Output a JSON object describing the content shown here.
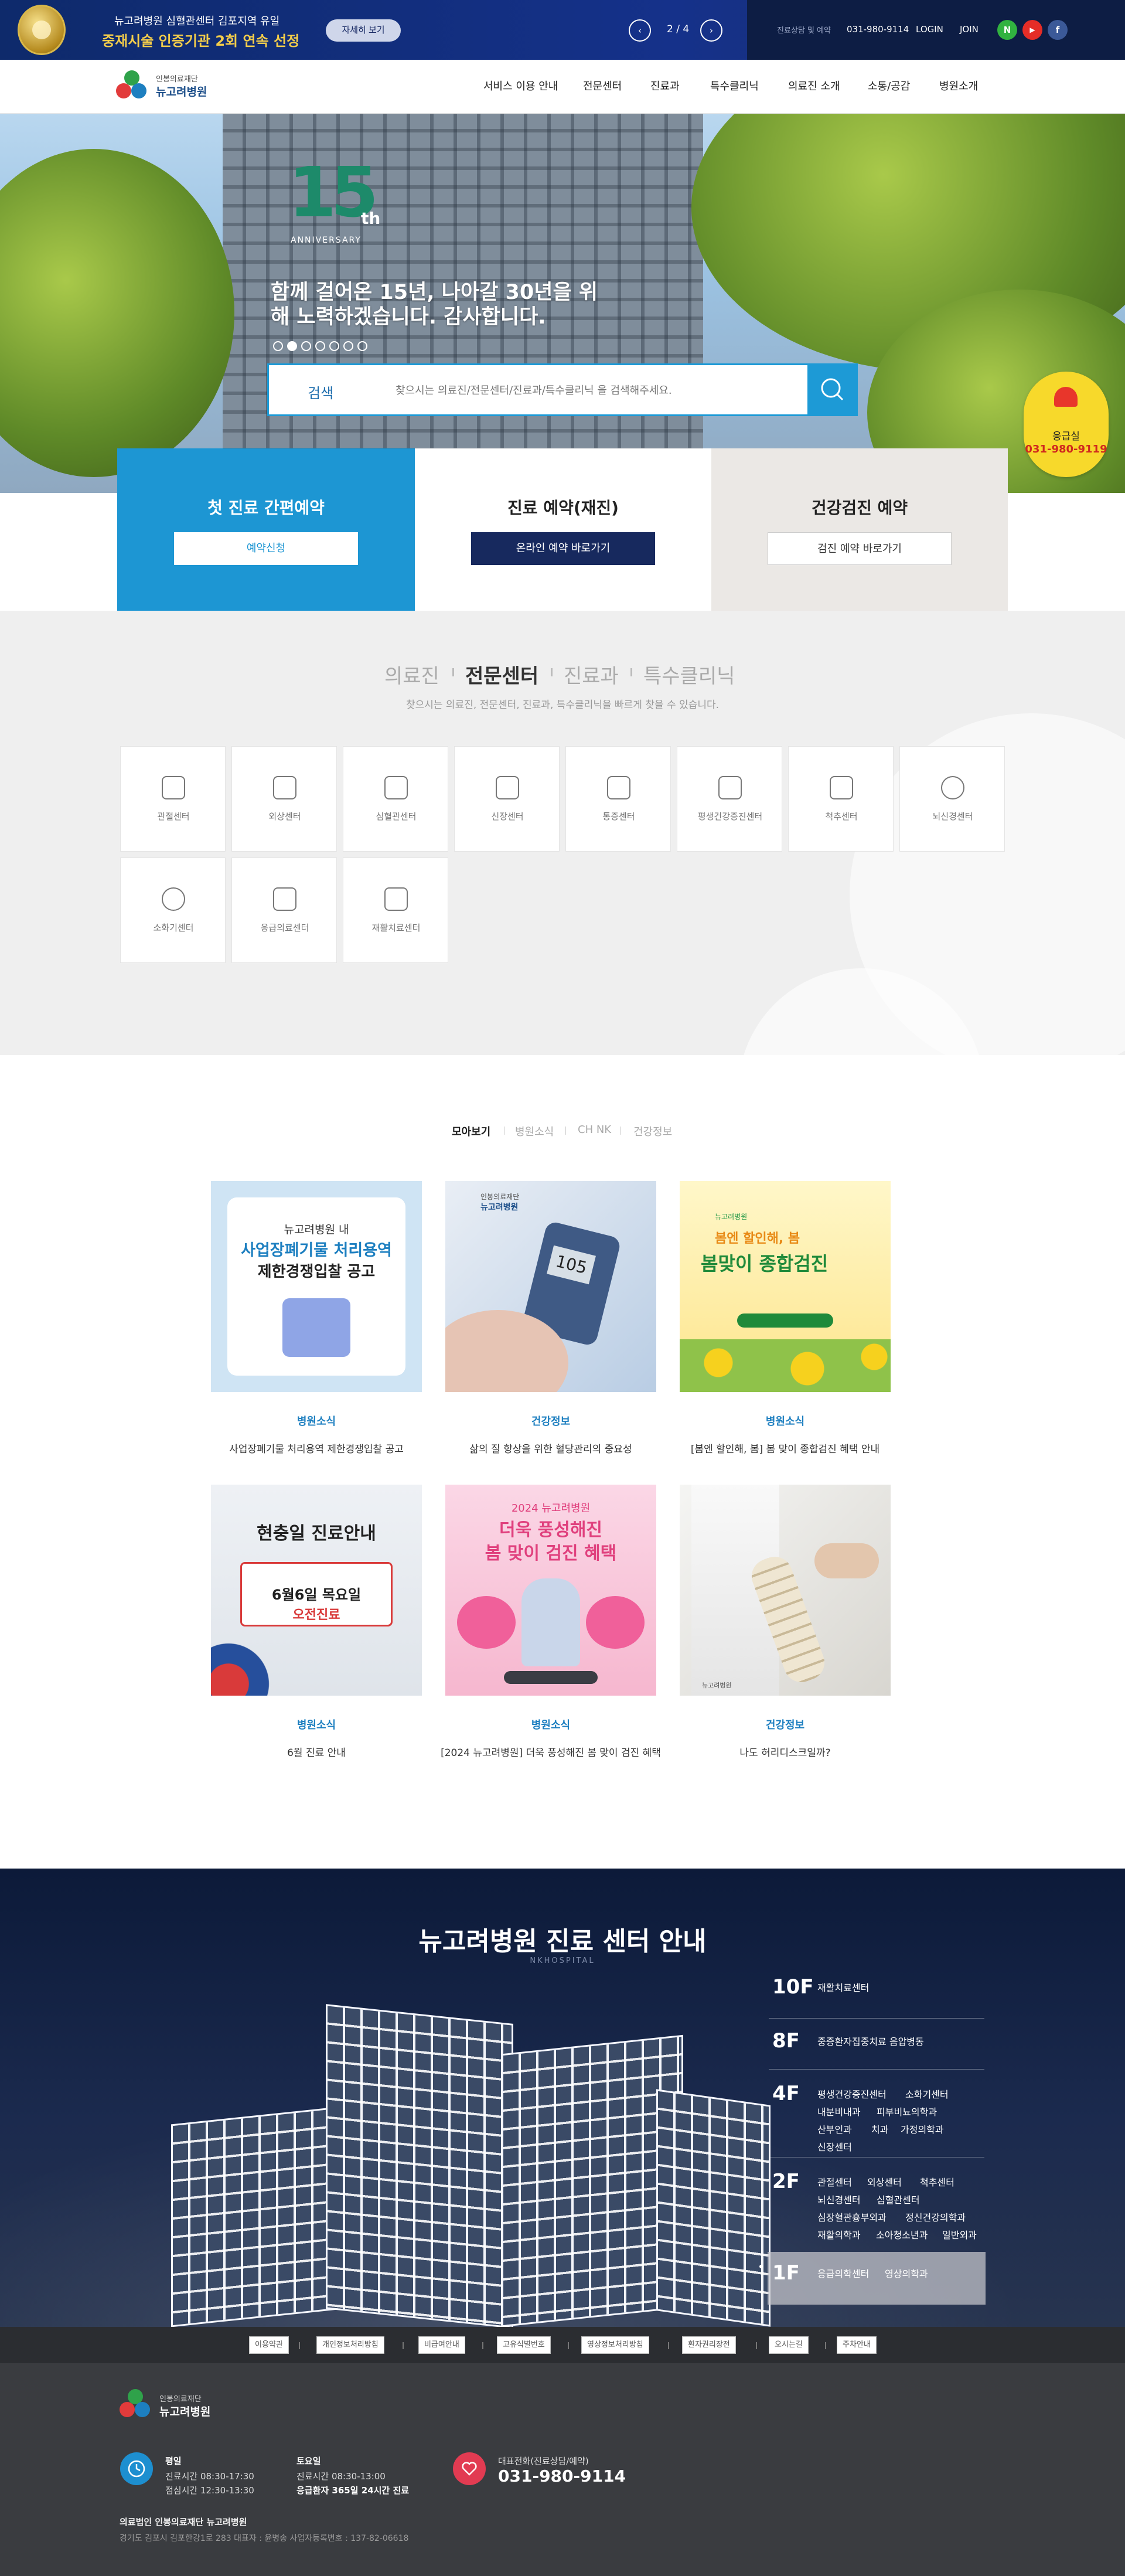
{
  "topbar": {
    "line1": "뉴고려병원 심혈관센터 김포지역 유일",
    "line2": "중재시술 인증기관 2회 연속 선정",
    "detail_btn": "자세히 보기",
    "pager": "2 / 4",
    "prev_icon": "‹",
    "next_icon": "›",
    "phone_label": "진료상담 및 예약",
    "phone": "031-980-9114",
    "login": "LOGIN",
    "join": "JOIN",
    "social": [
      "N",
      "▶",
      "f"
    ]
  },
  "header": {
    "logo_top": "인봉의료재단",
    "logo_main": "뉴고려병원",
    "nav": [
      "서비스 이용 안내",
      "전문센터",
      "진료과",
      "특수클리닉",
      "의료진 소개",
      "소통/공감",
      "병원소개"
    ]
  },
  "hero": {
    "anniv_num": "15",
    "anniv_th": "th",
    "anniv_sub": "ANNIVERSARY",
    "message": "함께 걸어온 15년, 나아갈 30년을 위해 노력하겠습니다. 감사합니다.",
    "dot_count": 7,
    "active_dot": 1,
    "search_label": "검색",
    "search_placeholder": "찾으시는 의료진/전문센터/진료과/특수클리닉 을 검색해주세요."
  },
  "emergency": {
    "label": "응급실",
    "phone": "031-980-9119"
  },
  "quick_cards": [
    {
      "title": "첫 진료 간편예약",
      "button": "예약신청"
    },
    {
      "title": "진료 예약(재진)",
      "button": "온라인 예약 바로가기"
    },
    {
      "title": "건강검진 예약",
      "button": "검진 예약 바로가기"
    }
  ],
  "category": {
    "tabs": [
      "의료진",
      "전문센터",
      "진료과",
      "특수클리닉"
    ],
    "active_tab": 1,
    "description": "찾으시는 의료진, 전문센터, 진료과, 특수클리닉을 빠르게 찾을 수 있습니다.",
    "centers": [
      "관절센터",
      "외상센터",
      "심혈관센터",
      "신장센터",
      "통증센터",
      "평생건강증진센터",
      "척추센터",
      "뇌신경센터",
      "소화기센터",
      "응급의료센터",
      "재활치료센터"
    ]
  },
  "news": {
    "tabs": [
      "모아보기",
      "병원소식",
      "CH NK",
      "건강정보"
    ],
    "active_tab": 0,
    "items": [
      {
        "category": "병원소식",
        "title": "사업장폐기물 처리용역 제한경쟁입찰 공고",
        "img_line1": "뉴고려병원 내",
        "img_line2": "사업장폐기물 처리용역",
        "img_line3": "제한경쟁입찰 공고"
      },
      {
        "category": "건강정보",
        "title": "삶의 질 향상을 위한 혈당관리의 중요성",
        "img_line1": "인봉의료재단",
        "img_line2": "뉴고려병원",
        "img_line3": "105"
      },
      {
        "category": "병원소식",
        "title": "[봄엔 할인해, 봄] 봄 맞이 종합검진 혜택 안내",
        "img_line1": "뉴고려병원",
        "img_line2": "봄엔 할인해, 봄",
        "img_line3": "봄맞이 종합검진"
      },
      {
        "category": "병원소식",
        "title": "6월 진료 안내",
        "img_line1": "현충일 진료안내",
        "img_line2": "6월6일 목요일",
        "img_line3": "오전진료"
      },
      {
        "category": "병원소식",
        "title": "[2024 뉴고려병원] 더욱 풍성해진 봄 맞이 검진 혜택",
        "img_line1": "2024 뉴고려병원",
        "img_line2": "더욱 풍성해진",
        "img_line3": "봄 맞이 검진 혜택"
      },
      {
        "category": "건강정보",
        "title": "나도 허리디스크일까?",
        "img_line1": "뉴고려병원",
        "img_line2": "",
        "img_line3": ""
      }
    ]
  },
  "floors": {
    "title": "뉴고려병원 진료 센터 안내",
    "subtitle": "NKHOSPITAL",
    "list": [
      {
        "floor": "10F",
        "depts": [
          "재활치료센터"
        ]
      },
      {
        "floor": "8F",
        "depts": [
          "중증환자집중치료 음압병동"
        ]
      },
      {
        "floor": "4F",
        "depts": [
          "평생건강증진센터",
          "소화기센터",
          "내분비내과",
          "피부비뇨의학과",
          "산부인과",
          "치과",
          "가정의학과",
          "신장센터"
        ]
      },
      {
        "floor": "2F",
        "depts": [
          "관절센터",
          "외상센터",
          "척추센터",
          "뇌신경센터",
          "심혈관센터",
          "심장혈관흉부외과",
          "정신건강의학과",
          "재활의학과",
          "소아청소년과",
          "일반외과"
        ]
      },
      {
        "floor": "1F",
        "depts": [
          "응급의학센터",
          "영상의학과"
        ]
      }
    ]
  },
  "footer": {
    "links": [
      "이용약관",
      "개인정보처리방침",
      "비급여안내",
      "고유식별번호",
      "영상정보처리방침",
      "환자권리장전",
      "오시는길",
      "주차안내"
    ],
    "logo_top": "인봉의료재단",
    "logo_main": "뉴고려병원",
    "weekday_label": "평일",
    "weekday_hours": "진료시간 08:30-17:30",
    "weekday_lunch": "점심시간 12:30-13:30",
    "sat_label": "토요일",
    "sat_hours": "진료시간 08:30-13:00",
    "sat_emergency": "응급환자 365일 24시간 진료",
    "rep_label": "대표전화(진료상담/예약)",
    "rep_phone": "031-980-9114",
    "corp": "의료법인 인봉의료재단 뉴고려병원",
    "address": "경기도 김포시 김포한강1로 283    대표자 : 윤병송    사업자등록번호 : 137-82-06618"
  }
}
